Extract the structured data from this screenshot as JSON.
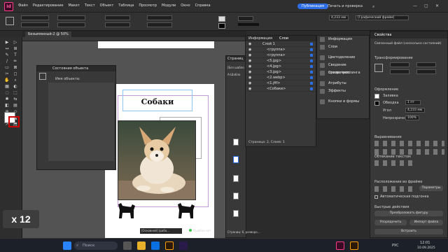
{
  "app": {
    "logo": "Id"
  },
  "menu": [
    "Файл",
    "Редактирование",
    "Макет",
    "Текст",
    "Объект",
    "Таблица",
    "Просмотр",
    "Модули",
    "Окно",
    "Справка"
  ],
  "header": {
    "publish_label": "Публикация",
    "print_review_label": "Печать и проверка",
    "zoom_field": "4,233 мм",
    "frame_type": "[Графический фрейм]"
  },
  "document": {
    "tab_label": "Безымянный-2 @ 50%",
    "title_text": "Собаки",
    "zoom_badge": "x 12"
  },
  "state_panel": {
    "title": "Состояния объекта",
    "object_name_label": "Имя объекта:"
  },
  "pages_panel": {
    "title": "Страниц",
    "none_label": "[Без шабло",
    "master_label": "A-Шабло",
    "status": "Страниц: 6, разворо..."
  },
  "layers_panel": {
    "tabs": [
      "Информация",
      "Слои"
    ],
    "rows": [
      "Слой 1",
      "<группа>",
      "<группа>",
      "<5.jpg>",
      "<4.jpg>",
      "<3.jpg>",
      "<2.webp>",
      "<1.jfif>",
      "<Собаки>"
    ],
    "status": "Страница: 2, Слоев: 1"
  },
  "right_list": [
    {
      "label": "Информация",
      "icon": "info-icon"
    },
    {
      "label": "Слои",
      "icon": "layers-icon"
    },
    {
      "label": "Цветоделение",
      "icon": "separations-icon"
    },
    {
      "label": "Сведение прозрачнос...",
      "icon": "flattener-icon"
    },
    {
      "label": "Стили треппинга",
      "icon": "trap-icon"
    },
    {
      "label": "Атрибуты",
      "icon": "attributes-icon"
    },
    {
      "label": "Эффекты",
      "icon": "effects-icon"
    },
    {
      "label": "Кнопки и формы",
      "icon": "buttons-icon"
    }
  ],
  "properties": {
    "title": "Свойства",
    "subtitle": "Связанный файл (несколько состояний)",
    "transform_label": "Трансформирование",
    "appearance_label": "Оформление",
    "fill_label": "Заливка",
    "stroke_label": "Обводка",
    "stroke_value": "1 пт",
    "corner_label": "Угол",
    "corner_value": "4,233 мм",
    "opacity_label": "Непрозрачн...",
    "opacity_value": "100%",
    "align_label": "Выравнивание",
    "wrap_label": "Обтекание текстом",
    "fitting_label": "Расположение во фрейме",
    "params_button": "Параметры",
    "autofit_label": "Автоматическая подгонка",
    "quick_actions_label": "Быстрые действия",
    "convert_button": "Преобразовать фигуру",
    "arrange_button": "Упорядочить",
    "import_button": "Импорт файла",
    "group_button": "Эскпорт",
    "reserve_button": "Встроить"
  },
  "statusbar": {
    "style": "[Основной] (рабо...",
    "errors": "Ошибок нет"
  },
  "taskbar": {
    "search_placeholder": "Поиск",
    "language": "РУС",
    "time": "12:01",
    "date": "10.09.2025"
  },
  "colors": {
    "accent": "#2d6ee6",
    "brand": "#ff3d8a",
    "panel": "#383838",
    "selection": "#8ec6ef"
  }
}
